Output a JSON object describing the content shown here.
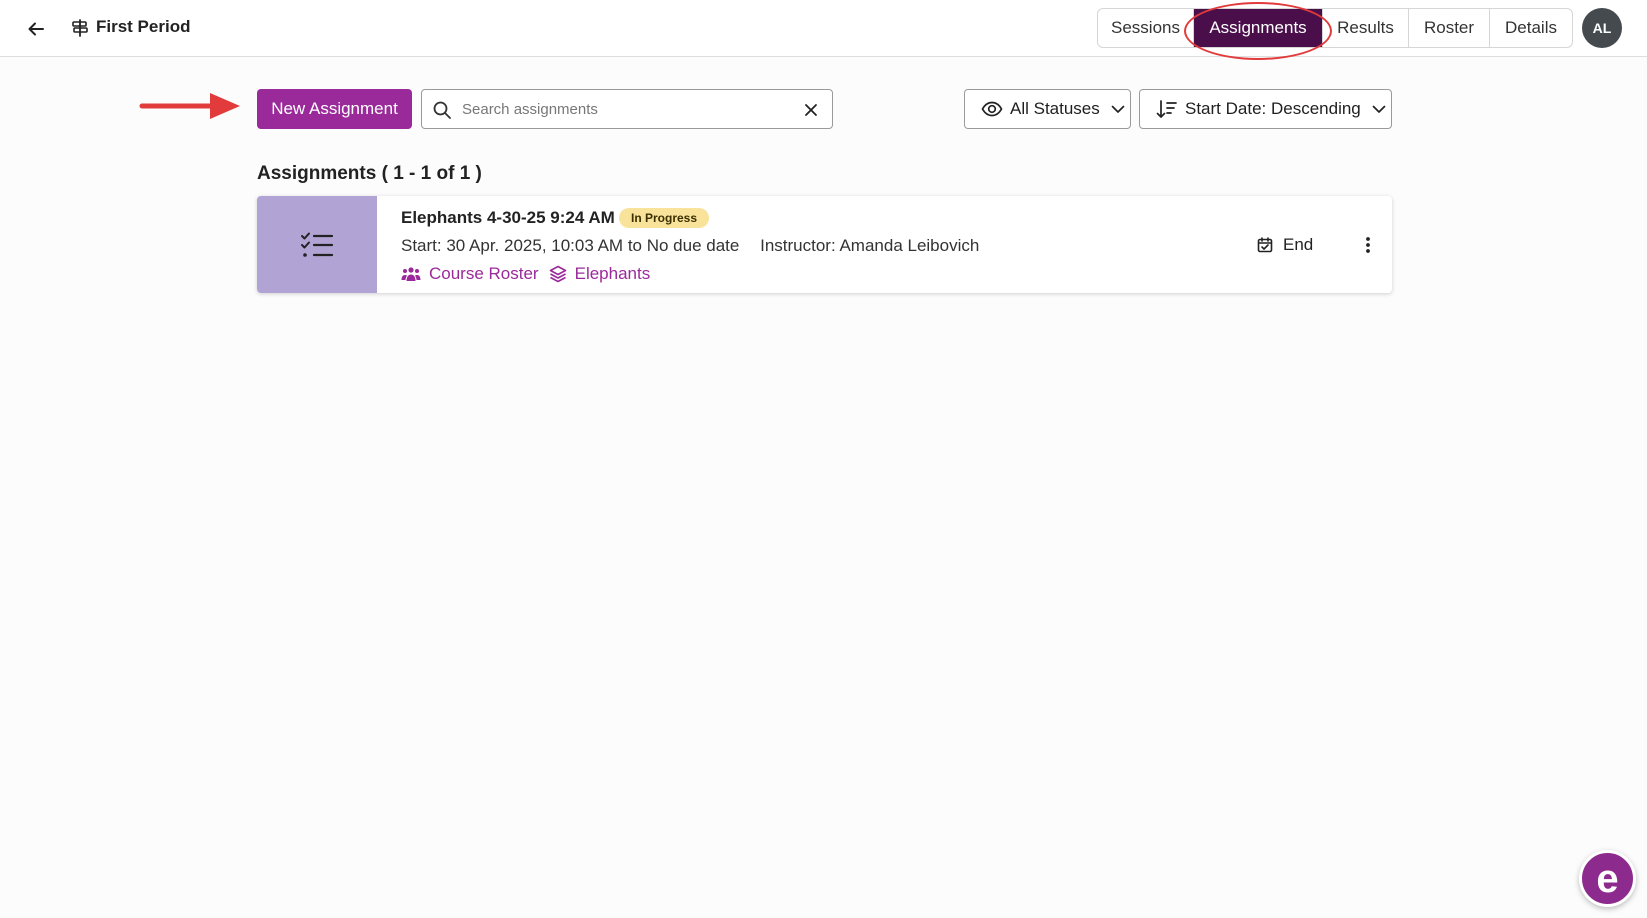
{
  "header": {
    "course_title": "First Period",
    "tabs": [
      {
        "label": "Sessions",
        "active": false
      },
      {
        "label": "Assignments",
        "active": true
      },
      {
        "label": "Results",
        "active": false
      },
      {
        "label": "Roster",
        "active": false
      },
      {
        "label": "Details",
        "active": false
      }
    ],
    "avatar_initials": "AL"
  },
  "toolbar": {
    "new_assignment_label": "New Assignment",
    "search_placeholder": "Search assignments",
    "search_value": "",
    "status_filter_label": "All Statuses",
    "sort_label": "Start Date: Descending"
  },
  "list": {
    "heading": "Assignments ( 1 - 1 of 1 )",
    "items": [
      {
        "title": "Elephants 4-30-25 9:24 AM",
        "status": "In Progress",
        "schedule": "Start: 30 Apr. 2025, 10:03 AM to No due date",
        "instructor": "Instructor: Amanda Leibovich",
        "roster_link": "Course Roster",
        "content_link": "Elephants",
        "end_label": "End"
      }
    ]
  },
  "help_widget_glyph": "e",
  "colors": {
    "brand_purple": "#9a2a9a",
    "active_tab": "#4a0f4a",
    "thumb": "#b1a4d5",
    "badge": "#f9e39b",
    "annotation_red": "#e23b3b"
  },
  "icons": {
    "back": "arrow-left-icon",
    "course": "signpost-icon",
    "search": "search-icon",
    "clear": "close-icon",
    "status": "eye-icon",
    "sort": "sort-descending-icon",
    "chevron": "chevron-down-icon",
    "assignment": "checklist-icon",
    "roster": "users-icon",
    "content": "layers-icon",
    "end": "calendar-check-icon",
    "more": "more-vertical-icon"
  }
}
